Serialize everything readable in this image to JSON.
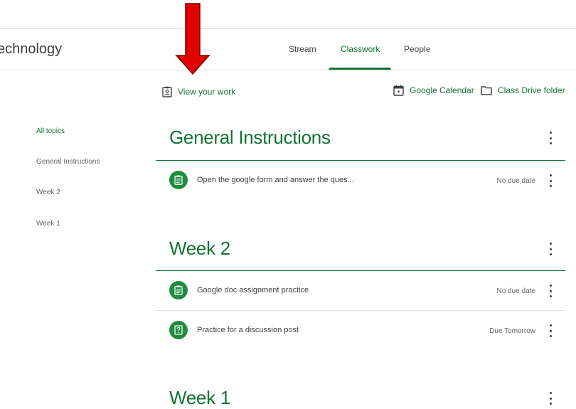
{
  "header": {
    "class_title": "Technology",
    "tabs": [
      {
        "label": "Stream",
        "active": false
      },
      {
        "label": "Classwork",
        "active": true
      },
      {
        "label": "People",
        "active": false
      }
    ]
  },
  "toolbar": {
    "view_work_label": "View your work",
    "calendar_label": "Google Calendar",
    "drive_label": "Class Drive folder"
  },
  "sidebar": {
    "items": [
      {
        "label": "All topics",
        "active": true
      },
      {
        "label": "General Instructions",
        "active": false
      },
      {
        "label": "Week 2",
        "active": false
      },
      {
        "label": "Week 1",
        "active": false
      }
    ]
  },
  "topics": [
    {
      "title": "General Instructions",
      "items": [
        {
          "title": "Open the google form and answer the ques...",
          "due": "No due date",
          "icon": "assignment-icon"
        }
      ]
    },
    {
      "title": "Week 2",
      "items": [
        {
          "title": "Google doc assignment practice",
          "due": "No due date",
          "icon": "assignment-icon"
        },
        {
          "title": "Practice for a discussion post",
          "due": "Due Tomorrow",
          "icon": "question-icon"
        }
      ]
    },
    {
      "title": "Week 1",
      "items": []
    }
  ],
  "colors": {
    "accent": "#137333",
    "icon_bg": "#1e8e3e",
    "arrow": "#e00000"
  }
}
